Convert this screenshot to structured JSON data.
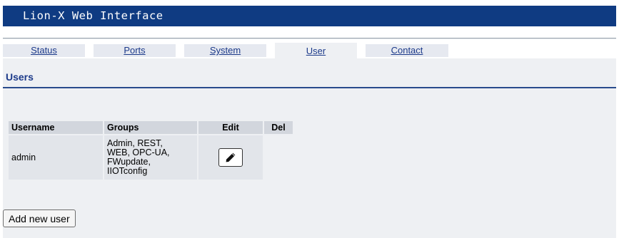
{
  "app": {
    "title": "Lion-X Web Interface"
  },
  "tabs": [
    {
      "label": "Status",
      "active": false
    },
    {
      "label": "Ports",
      "active": false
    },
    {
      "label": "System",
      "active": false
    },
    {
      "label": "User",
      "active": true
    },
    {
      "label": "Contact",
      "active": false
    }
  ],
  "page": {
    "heading": "Users"
  },
  "table": {
    "headers": {
      "username": "Username",
      "groups": "Groups",
      "edit": "Edit",
      "del": "Del"
    },
    "rows": [
      {
        "username": "admin",
        "groups": [
          "Admin, REST,",
          "WEB, OPC-UA,",
          "FWupdate,",
          "IIOTconfig"
        ],
        "edit_icon": "pencil-icon"
      }
    ]
  },
  "actions": {
    "add_user": "Add new user"
  },
  "colors": {
    "title_bar": "#0f3b82",
    "link": "#1c3a8a",
    "content_bg": "#eef0f3"
  }
}
